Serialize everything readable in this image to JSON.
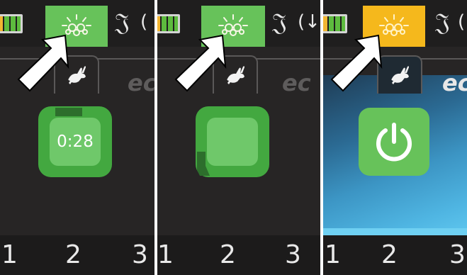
{
  "panels": [
    {
      "state": "countdown",
      "timer": "0:28",
      "light_tab_color": "#67c25a",
      "mode_numbers": [
        "1",
        "2",
        "3"
      ],
      "brand": "ec"
    },
    {
      "state": "countdown-complete",
      "light_tab_color": "#67c25a",
      "mode_numbers": [
        "1",
        "2",
        "3"
      ],
      "brand": "ec"
    },
    {
      "state": "power",
      "light_tab_color": "#f5b81c",
      "mode_numbers": [
        "1",
        "2",
        "3"
      ],
      "brand": "ec"
    }
  ],
  "icons": {
    "battery": "battery-icon",
    "light": "light-icon",
    "hearing": "ear-icon",
    "rabbit": "rabbit-icon",
    "power": "power-icon",
    "pointer": "arrow-pointer-icon"
  },
  "colors": {
    "green": "#67c25a",
    "amber": "#f5b81c",
    "dark": "#272525"
  }
}
